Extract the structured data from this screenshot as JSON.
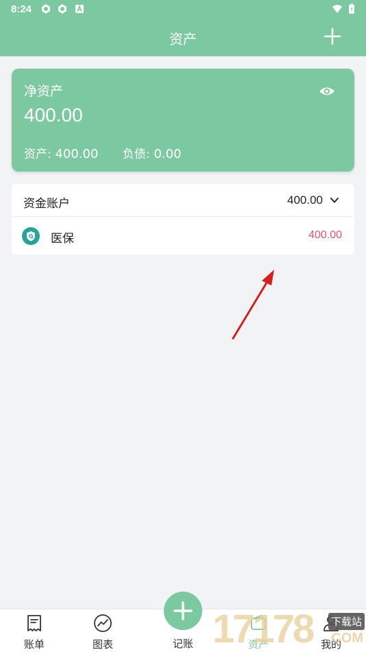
{
  "status_bar": {
    "time": "8:24",
    "icons": [
      "settings-badge-icon",
      "settings-badge-icon",
      "a-notification-icon"
    ],
    "right_icons": [
      "wifi-icon",
      "battery-icon"
    ]
  },
  "app_bar": {
    "title": "资产",
    "add_icon": "plus-icon"
  },
  "net_assets_card": {
    "label": "净资产",
    "amount": "400.00",
    "visibility_icon": "eye-icon",
    "assets_label": "资产:",
    "assets_value": "400.00",
    "liabilities_label": "负债:",
    "liabilities_value": "0.00"
  },
  "accounts": {
    "group_title": "资金账户",
    "group_total": "400.00",
    "items": [
      {
        "name": "医保",
        "amount": "400.00",
        "icon": "shield-icon"
      }
    ]
  },
  "tabs": [
    {
      "label": "账单",
      "icon": "bill-icon"
    },
    {
      "label": "图表",
      "icon": "chart-icon"
    },
    {
      "label": "记账",
      "icon": "plus-icon"
    },
    {
      "label": "资产",
      "icon": "wallet-icon"
    },
    {
      "label": "我的",
      "icon": "user-icon"
    }
  ],
  "watermark": {
    "digits": "17178",
    "badge": "下载站",
    "suffix": "COM"
  },
  "colors": {
    "primary": "#7cc8a0",
    "amount_red": "#e0566f",
    "account_icon": "#27a39a",
    "background": "#f2f3f5"
  }
}
